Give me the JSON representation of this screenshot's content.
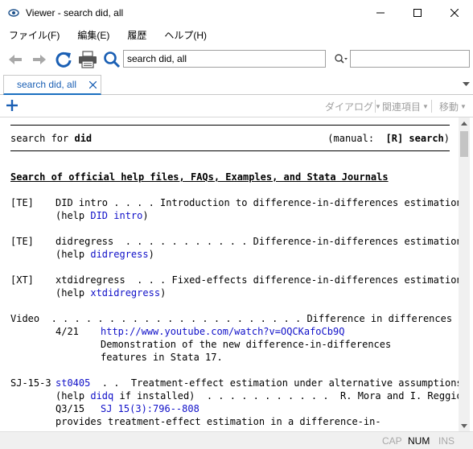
{
  "window": {
    "title": "Viewer - search did, all",
    "icons": [
      "eye-icon",
      "minimize-icon",
      "maximize-icon",
      "close-icon"
    ]
  },
  "menu": {
    "items": [
      "ファイル(F)",
      "編集(E)",
      "履歴",
      "ヘルプ(H)"
    ]
  },
  "toolbar": {
    "search_value": "search did, all",
    "find_value": "",
    "icons": [
      "back-arrow-icon",
      "forward-arrow-icon",
      "refresh-icon",
      "print-icon",
      "search-magnifier-icon",
      "find-icon"
    ]
  },
  "tab": {
    "label": "search did, all"
  },
  "subtoolbar": {
    "dialog_label": "ダイアログ",
    "related_label": "関連項目",
    "jump_label": "移動"
  },
  "content": {
    "header_left": "search for ",
    "header_term": "did",
    "header_right_prefix": "(manual:  ",
    "header_right_ref": "[R] search",
    "header_right_suffix": ")",
    "section_title": "Search of official help files, FAQs, Examples, and Stata Journals",
    "entries": [
      {
        "tag": "[TE]",
        "line1_name": "DID intro",
        "line1_rest": " . . . . Introduction to difference-in-differences estimation",
        "help_prefix": "(help ",
        "help_link": "DID intro",
        "help_suffix": ")"
      },
      {
        "tag": "[TE]",
        "line1_name": "didregress",
        "line1_rest": "  . . . . . . . . . . . Difference-in-differences estimation",
        "help_prefix": "(help ",
        "help_link": "didregress",
        "help_suffix": ")"
      },
      {
        "tag": "[XT]",
        "line1_name": "xtdidregress",
        "line1_rest": "  . . . Fixed-effects difference-in-differences estimation",
        "help_prefix": "(help ",
        "help_link": "xtdidregress",
        "help_suffix": ")"
      }
    ],
    "video": {
      "tag": "Video",
      "line1": "  . . . . . . . . . . . . . . . . . . . . . . Difference in differences",
      "date": "4/21",
      "url": "http://www.youtube.com/watch?v=OQCKafoCb9Q",
      "desc1": "Demonstration of the new difference-in-differences",
      "desc2": "features in Stata 17."
    },
    "sj": {
      "tag": "SJ-15-3",
      "code": "st0405",
      "title_rest": "  . .  Treatment-effect estimation under alternative assumptions",
      "help_prefix": "(help ",
      "help_link": "didq",
      "help_suffix": " if installed)  . . . . . . . . . . .  R. Mora and I. Reggio",
      "q_label": "Q3/15",
      "journal_link": "SJ 15(3):796--808",
      "desc": "provides treatment-effect estimation in a difference-in-"
    }
  },
  "status": {
    "cap": "CAP",
    "num": "NUM",
    "ins": "INS"
  }
}
